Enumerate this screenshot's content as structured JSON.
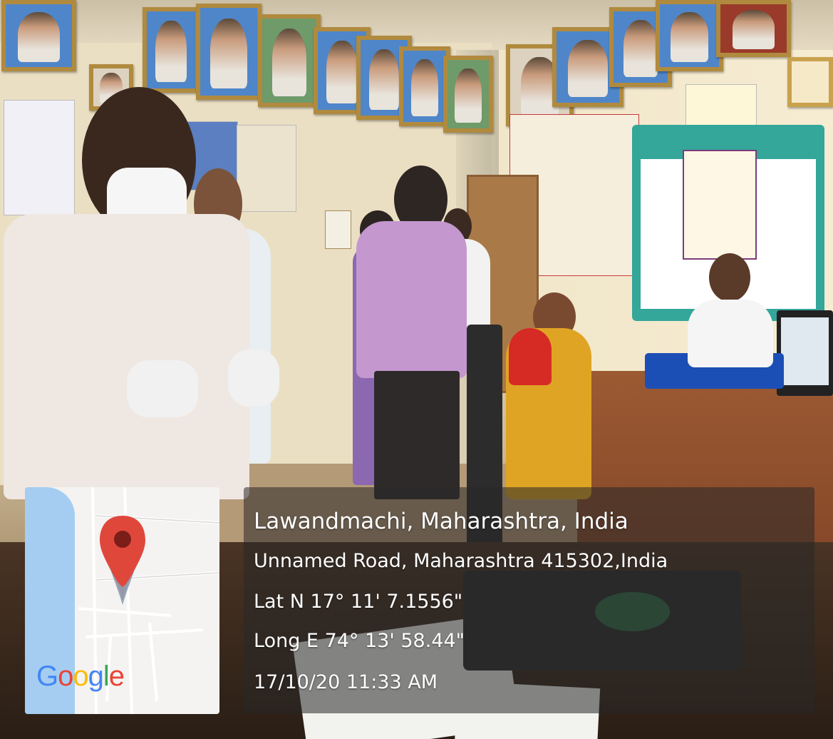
{
  "overlay": {
    "place": "Lawandmachi, Maharashtra, India",
    "address": "Unnamed Road, Maharashtra 415302,India",
    "latitude": "Lat N 17° 11' 7.1556\"",
    "longitude": "Long E 74° 13' 58.44\"",
    "timestamp": "17/10/20 11:33 AM"
  },
  "map": {
    "logo_letters": [
      "G",
      "o",
      "o",
      "g",
      "l",
      "e"
    ],
    "logo_colors": [
      "#4285F4",
      "#EA4335",
      "#FBBC05",
      "#4285F4",
      "#34A853",
      "#EA4335"
    ],
    "pin_color": "#E0473B",
    "water_color": "#A5CDF2",
    "icon": "map-pin-icon"
  },
  "banner": {
    "color": "#34A69A"
  }
}
